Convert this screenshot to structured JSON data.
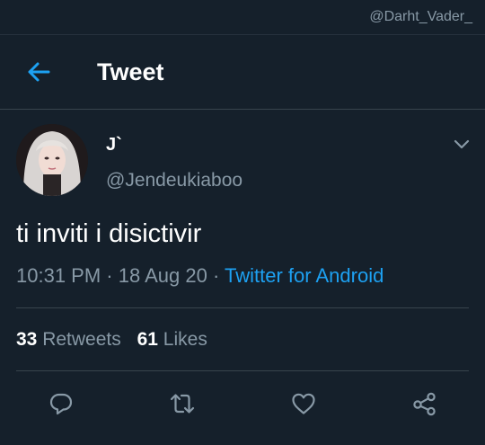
{
  "watermark": "@Darht_Vader_",
  "header": {
    "title": "Tweet",
    "back_icon": "arrow-left-icon"
  },
  "tweet": {
    "display_name": "J`",
    "handle": "@Jendeukiaboo",
    "text": "ti inviti i disictivir",
    "time": "10:31 PM",
    "date": "18 Aug 20",
    "separator": "·",
    "source": "Twitter for Android",
    "more_icon": "chevron-down-icon"
  },
  "stats": {
    "retweets_count": "33",
    "retweets_label": "Retweets",
    "likes_count": "61",
    "likes_label": "Likes"
  },
  "actions": [
    {
      "name": "reply",
      "icon": "reply-icon"
    },
    {
      "name": "retweet",
      "icon": "retweet-icon"
    },
    {
      "name": "like",
      "icon": "heart-icon"
    },
    {
      "name": "share",
      "icon": "share-icon"
    }
  ],
  "colors": {
    "background": "#15202b",
    "accent": "#1da1f2",
    "secondary_text": "#8899a6",
    "divider": "#38444d"
  }
}
